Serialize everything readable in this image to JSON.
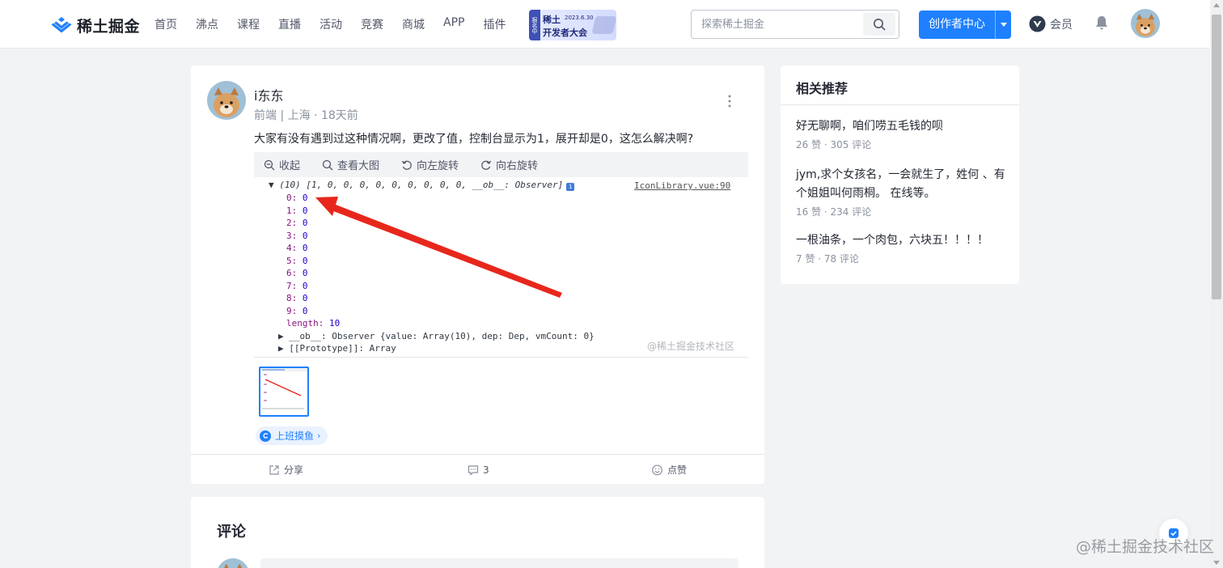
{
  "header": {
    "logo_text": "稀土掘金",
    "nav": [
      "首页",
      "沸点",
      "课程",
      "直播",
      "活动",
      "竞赛",
      "商城",
      "APP",
      "插件"
    ],
    "banner": {
      "tag": "报名中",
      "line1": "稀土",
      "date": "2023.6.30",
      "line2": "开发者大会"
    },
    "search_placeholder": "探索稀土掘金",
    "creator_label": "创作者中心",
    "vip_label": "会员"
  },
  "post": {
    "author": "i东东",
    "meta": "前端 | 上海 · 18天前",
    "text": "大家有没有遇到过这种情况啊，更改了值，控制台显示为1，展开却是0，这怎么解决啊?",
    "viewer_toolbar": [
      "收起",
      "查看大图",
      "向左旋转",
      "向右旋转"
    ],
    "console": {
      "header": "▼ (10) [1, 0, 0, 0, 0, 0, 0, 0, 0, 0, __ob__: Observer]",
      "file": "IconLibrary.vue:90",
      "items": [
        {
          "key": "0:",
          "val": "0"
        },
        {
          "key": "1:",
          "val": "0"
        },
        {
          "key": "2:",
          "val": "0"
        },
        {
          "key": "3:",
          "val": "0"
        },
        {
          "key": "4:",
          "val": "0"
        },
        {
          "key": "5:",
          "val": "0"
        },
        {
          "key": "6:",
          "val": "0"
        },
        {
          "key": "7:",
          "val": "0"
        },
        {
          "key": "8:",
          "val": "0"
        },
        {
          "key": "9:",
          "val": "0"
        }
      ],
      "length_key": "length:",
      "length_val": "10",
      "ob_line": "▶ __ob__: Observer {value: Array(10), dep: Dep, vmCount: 0}",
      "proto_line": "▶ [[Prototype]]: Array",
      "watermark": "@稀土掘金技术社区"
    },
    "topic": "上班摸鱼",
    "actions": {
      "share": "分享",
      "comments": "3",
      "like": "点赞"
    }
  },
  "comments": {
    "title": "评论"
  },
  "sidebar": {
    "title": "相关推荐",
    "items": [
      {
        "text": "好无聊啊，咱们唠五毛钱的呗",
        "meta": "26 赞 · 305 评论"
      },
      {
        "text": "jym,求个女孩名，一会就生了，姓何 、有个姐姐叫何雨桐。 在线等。",
        "meta": "16 赞 · 234 评论"
      },
      {
        "text": "一根油条，一个肉包，六块五！！！！",
        "meta": "7 赞 · 78 评论"
      }
    ]
  },
  "watermark": "@稀土掘金技术社区",
  "colors": {
    "brand": "#1e80ff",
    "arrow": "#e8271c",
    "bg": "#f2f3f5"
  }
}
